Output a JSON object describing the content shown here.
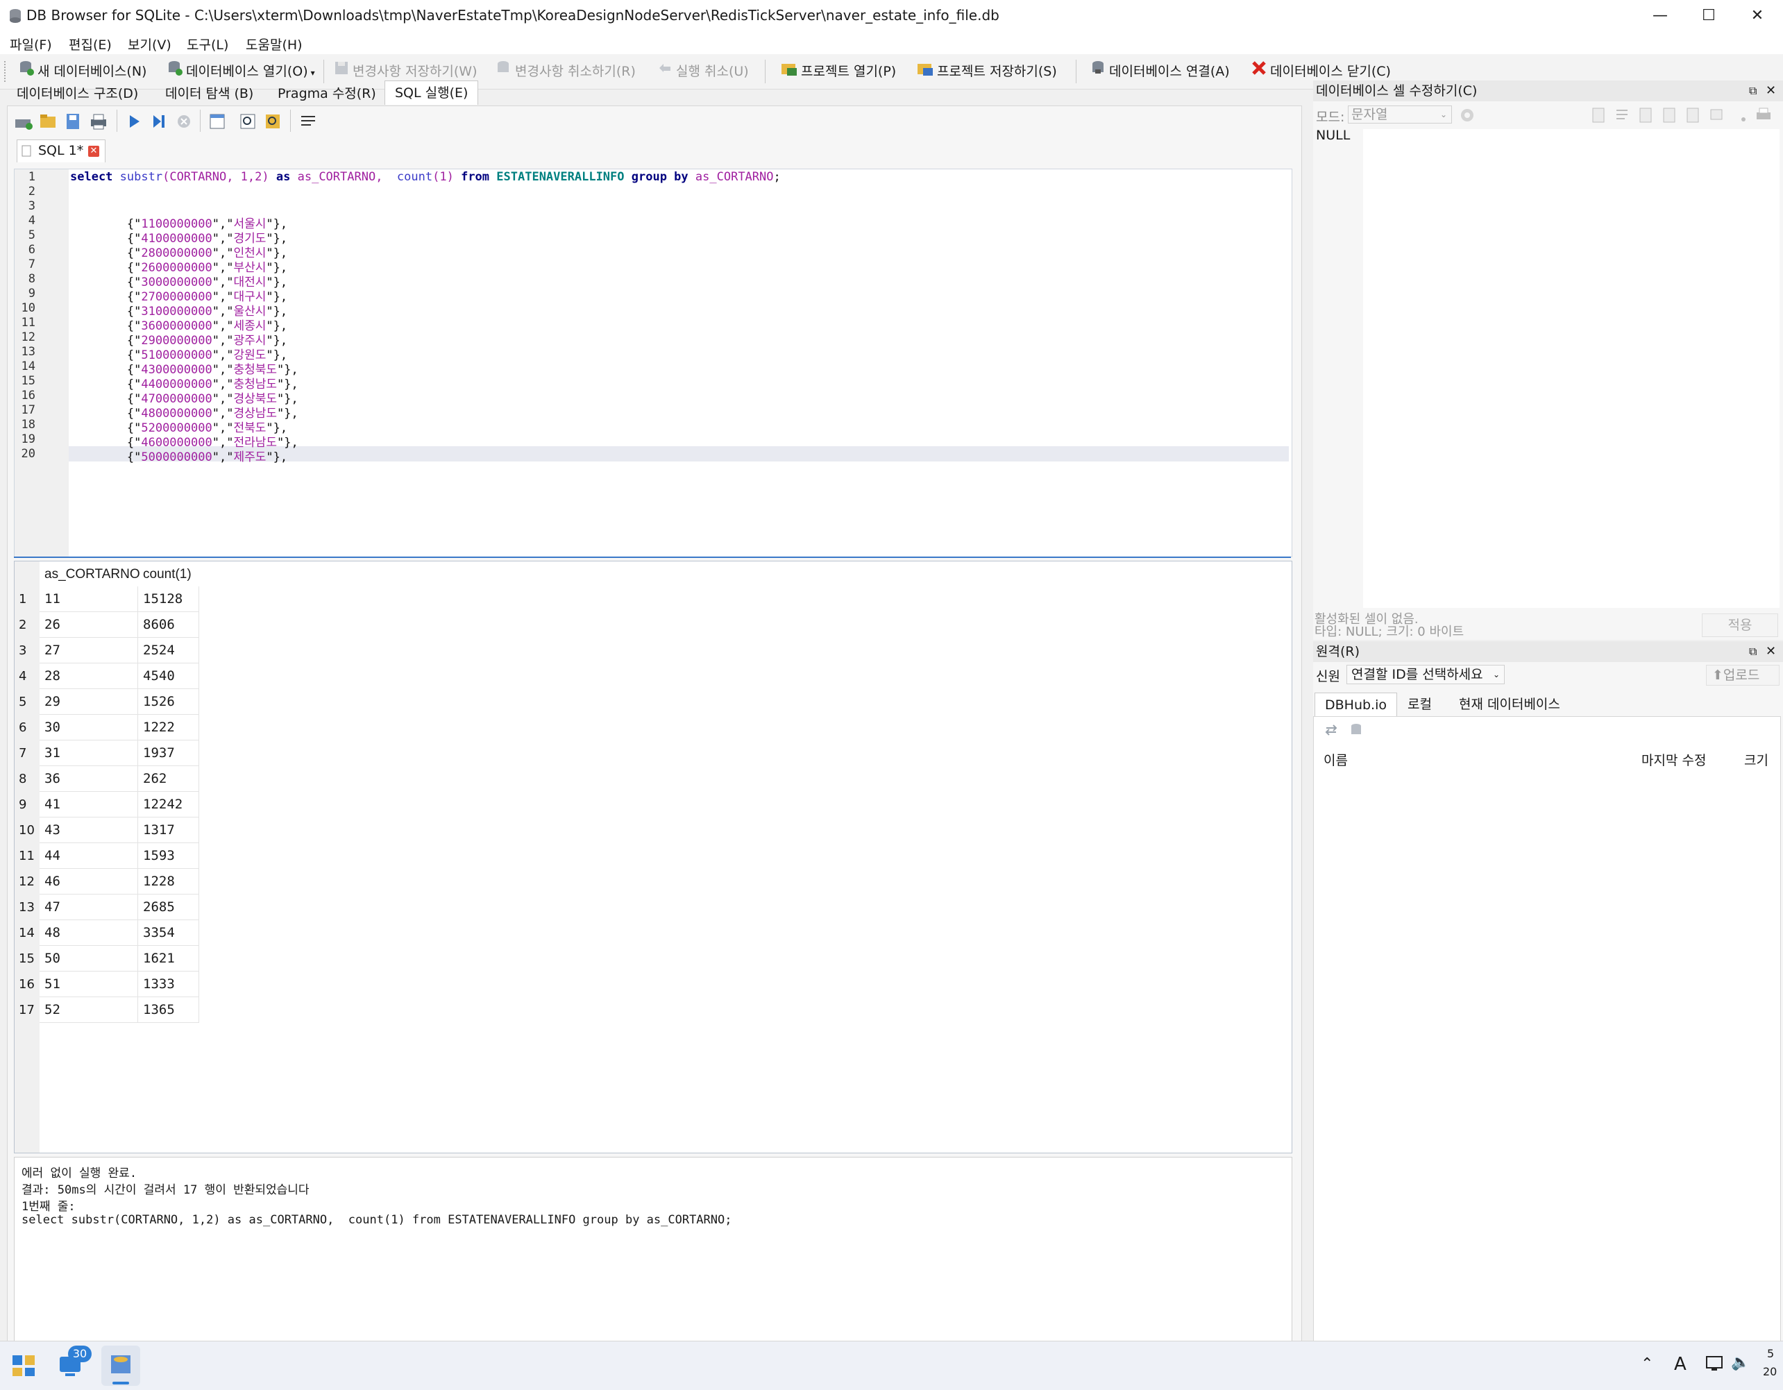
{
  "window": {
    "title": "DB Browser for SQLite - C:\\Users\\xterm\\Downloads\\tmp\\NaverEstateTmp\\KoreaDesignNodeServer\\RedisTickServer\\naver_estate_info_file.db",
    "minimize": "—",
    "maximize": "☐",
    "close": "✕"
  },
  "menu": [
    "파일(F)",
    "편집(E)",
    "보기(V)",
    "도구(L)",
    "도움말(H)"
  ],
  "toolbar": {
    "new_db": "새 데이터베이스(N)",
    "open_db": "데이터베이스 열기(O)",
    "write_changes": "변경사항 저장하기(W)",
    "revert_changes": "변경사항 취소하기(R)",
    "undo": "실행 취소(U)",
    "open_project": "프로젝트 열기(P)",
    "save_project": "프로젝트 저장하기(S)",
    "attach_db": "데이터베이스 연결(A)",
    "close_db": "데이터베이스 닫기(C)"
  },
  "tabs": [
    "데이터베이스 구조(D)",
    "데이터 탐색 (B)",
    "Pragma 수정(R)",
    "SQL 실행(E)"
  ],
  "sql_tab": {
    "label": "SQL 1*"
  },
  "editor": {
    "query": {
      "kw_select": "select",
      "fn_substr": "substr",
      "args1": "(CORTARNO, 1,2)",
      "kw_as": "as",
      "alias": "as_CORTARNO,",
      "fn_count": "count",
      "args2": "(1)",
      "kw_from": "from",
      "table": "ESTATENAVERALLINFO",
      "kw_group": "group by",
      "alias2": "as_CORTARNO",
      "semi": ";"
    },
    "lines": [
      {
        "n": "1"
      },
      {
        "n": "2"
      },
      {
        "n": "3"
      },
      {
        "n": "4",
        "code": "1100000000",
        "name": "서울시"
      },
      {
        "n": "5",
        "code": "4100000000",
        "name": "경기도"
      },
      {
        "n": "6",
        "code": "2800000000",
        "name": "인천시"
      },
      {
        "n": "7",
        "code": "2600000000",
        "name": "부산시"
      },
      {
        "n": "8",
        "code": "3000000000",
        "name": "대전시"
      },
      {
        "n": "9",
        "code": "2700000000",
        "name": "대구시"
      },
      {
        "n": "10",
        "code": "3100000000",
        "name": "울산시"
      },
      {
        "n": "11",
        "code": "3600000000",
        "name": "세종시"
      },
      {
        "n": "12",
        "code": "2900000000",
        "name": "광주시"
      },
      {
        "n": "13",
        "code": "5100000000",
        "name": "강원도"
      },
      {
        "n": "14",
        "code": "4300000000",
        "name": "충청북도"
      },
      {
        "n": "15",
        "code": "4400000000",
        "name": "충청남도"
      },
      {
        "n": "16",
        "code": "4700000000",
        "name": "경상북도"
      },
      {
        "n": "17",
        "code": "4800000000",
        "name": "경상남도"
      },
      {
        "n": "18",
        "code": "5200000000",
        "name": "전북도"
      },
      {
        "n": "19",
        "code": "4600000000",
        "name": "전라남도"
      },
      {
        "n": "20",
        "code": "5000000000",
        "name": "제주도"
      }
    ]
  },
  "results": {
    "columns": [
      "as_CORTARNO",
      "count(1)"
    ],
    "rows": [
      [
        "1",
        "11",
        "15128"
      ],
      [
        "2",
        "26",
        "8606"
      ],
      [
        "3",
        "27",
        "2524"
      ],
      [
        "4",
        "28",
        "4540"
      ],
      [
        "5",
        "29",
        "1526"
      ],
      [
        "6",
        "30",
        "1222"
      ],
      [
        "7",
        "31",
        "1937"
      ],
      [
        "8",
        "36",
        "262"
      ],
      [
        "9",
        "41",
        "12242"
      ],
      [
        "10",
        "43",
        "1317"
      ],
      [
        "11",
        "44",
        "1593"
      ],
      [
        "12",
        "46",
        "1228"
      ],
      [
        "13",
        "47",
        "2685"
      ],
      [
        "14",
        "48",
        "3354"
      ],
      [
        "15",
        "50",
        "1621"
      ],
      [
        "16",
        "51",
        "1333"
      ],
      [
        "17",
        "52",
        "1365"
      ]
    ]
  },
  "message": [
    "에러 없이 실행 완료.",
    "결과: 50ms의 시간이 걸려서 17 행이 반환되었습니다",
    "1번째 줄:",
    "select substr(CORTARNO, 1,2) as as_CORTARNO,  count(1) from ESTATENAVERALLINFO group by as_CORTARNO;"
  ],
  "edit_cell": {
    "title": "데이터베이스 셀 수정하기(C)",
    "mode_label": "모드:",
    "mode_value": "문자열",
    "content": "NULL",
    "status1": "활성화된 셀이 없음.",
    "status2": "타입: NULL; 크기: 0 바이트",
    "apply": "적용"
  },
  "remote": {
    "title": "원격(R)",
    "identity_label": "신원",
    "identity_value": "연결할 ID를 선택하세요",
    "upload": "업로드",
    "tabs": [
      "DBHub.io",
      "로컬",
      "현재 데이터베이스"
    ],
    "columns": [
      "이름",
      "마지막 수정",
      "크기"
    ]
  },
  "taskbar": {
    "badge": "30",
    "ime": "A",
    "clock_top": "5",
    "clock_bottom": "20"
  },
  "colors": {
    "accent": "#0b63c1",
    "keyword": "#00007f",
    "string": "#a020a0",
    "table": "#008080"
  }
}
